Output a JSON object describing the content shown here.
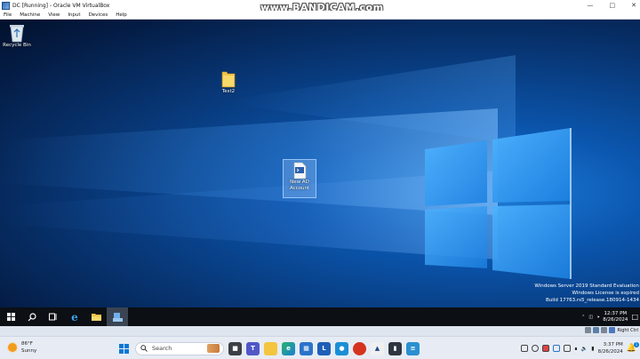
{
  "vbox": {
    "title": "DC [Running] - Oracle VM VirtualBox",
    "menu": [
      "File",
      "Machine",
      "View",
      "Input",
      "Devices",
      "Help"
    ],
    "overlay": "www.BANDICAM.com"
  },
  "desktop": {
    "icons": {
      "recycle_bin": "Recycle Bin",
      "folder": "Test2",
      "script_line1": "New AD",
      "script_line2": "Account"
    },
    "watermark": {
      "line1": "Windows Server 2019 Standard Evaluation",
      "line2": "Windows License is expired",
      "line3": "Build 17763.rs5_release.180914-1434"
    }
  },
  "guest_taskbar": {
    "time": "12:37 PM",
    "date": "8/26/2024"
  },
  "host_strip": {
    "right_ctrl": "Right Ctrl"
  },
  "host_taskbar": {
    "weather_temp": "86°F",
    "weather_desc": "Sunny",
    "search_placeholder": "Search",
    "time": "3:37 PM",
    "date": "8/26/2024",
    "notification_count": "1"
  },
  "colors": {
    "desktop_dark": "#02112c",
    "desktop_glow": "#1f7fd8",
    "guest_taskbar": "#0c0f14",
    "host_taskbar": "#e7ecf4",
    "accent": "#0078d4"
  }
}
